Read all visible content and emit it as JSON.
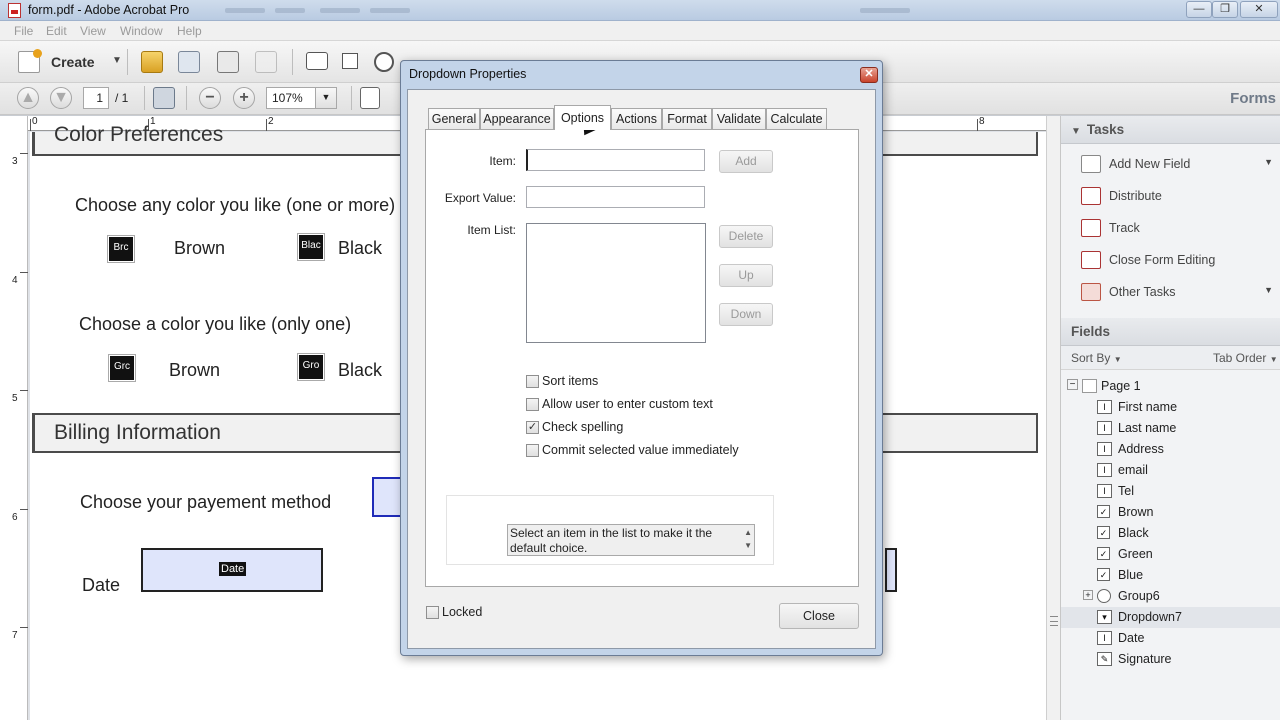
{
  "window": {
    "title": "form.pdf - Adobe Acrobat Pro",
    "controls": [
      "—",
      "❐",
      "✕"
    ]
  },
  "menu": [
    "File",
    "Edit",
    "View",
    "Window",
    "Help"
  ],
  "toolbar": {
    "create_label": "Create",
    "page_current": "1",
    "page_total": "/ 1",
    "zoom": "107%",
    "forms_label": "Forms"
  },
  "rulers": {
    "horizontal": [
      "0",
      "1",
      "2",
      "8"
    ],
    "vertical": [
      "3",
      "4",
      "5",
      "6",
      "7"
    ]
  },
  "document": {
    "color_section_title": "Color Preferences",
    "choose_any": "Choose any color you like (one or more)",
    "choose_one": "Choose a color you like (only one)",
    "field_brown_check": "Brc",
    "field_black_check": "Blac",
    "field_brown_radio": "Grc",
    "field_black_radio": "Gro",
    "brown": "Brown",
    "black": "Black",
    "billing_title": "Billing Information",
    "payment_label": "Choose your payement method",
    "date_label": "Date",
    "date_field": "Date"
  },
  "dialog": {
    "title": "Dropdown Properties",
    "tabs": [
      "General",
      "Appearance",
      "Options",
      "Actions",
      "Format",
      "Validate",
      "Calculate"
    ],
    "active_tab": "Options",
    "item_label": "Item:",
    "export_label": "Export Value:",
    "itemlist_label": "Item List:",
    "item_value": "",
    "export_value": "",
    "add_button": "Add",
    "delete_button": "Delete",
    "up_button": "Up",
    "down_button": "Down",
    "checkboxes": [
      {
        "label": "Sort items",
        "checked": false
      },
      {
        "label": "Allow user to enter custom text",
        "checked": false
      },
      {
        "label": "Check spelling",
        "checked": true
      },
      {
        "label": "Commit selected value immediately",
        "checked": false
      }
    ],
    "hint": "Select an item in the list to make it the default choice.",
    "locked_label": "Locked",
    "close_button": "Close"
  },
  "tasks_panel": {
    "header": "Tasks",
    "items": [
      {
        "label": "Add New Field",
        "has_menu": true
      },
      {
        "label": "Distribute",
        "has_menu": false
      },
      {
        "label": "Track",
        "has_menu": false
      },
      {
        "label": "Close Form Editing",
        "has_menu": false
      },
      {
        "label": "Other Tasks",
        "has_menu": true
      }
    ]
  },
  "fields_panel": {
    "header": "Fields",
    "sort_by": "Sort By",
    "tab_order": "Tab Order",
    "tree": [
      {
        "label": "Page 1",
        "type": "page",
        "level": 0
      },
      {
        "label": "First name",
        "type": "text",
        "level": 1
      },
      {
        "label": "Last name",
        "type": "text",
        "level": 1
      },
      {
        "label": "Address",
        "type": "text",
        "level": 1
      },
      {
        "label": "email",
        "type": "text",
        "level": 1
      },
      {
        "label": "Tel",
        "type": "text",
        "level": 1
      },
      {
        "label": "Brown",
        "type": "check",
        "level": 1
      },
      {
        "label": "Black",
        "type": "check",
        "level": 1
      },
      {
        "label": "Green",
        "type": "check",
        "level": 1
      },
      {
        "label": "Blue",
        "type": "check",
        "level": 1
      },
      {
        "label": "Group6",
        "type": "group",
        "level": 1
      },
      {
        "label": "Dropdown7",
        "type": "dropdown",
        "level": 1,
        "selected": true
      },
      {
        "label": "Date",
        "type": "text",
        "level": 1
      },
      {
        "label": "Signature",
        "type": "signature",
        "level": 1
      }
    ]
  },
  "colors": {
    "accent": "#c3d4e9",
    "field_fill": "#dfe5fb",
    "selection": "#1f2bb8"
  }
}
